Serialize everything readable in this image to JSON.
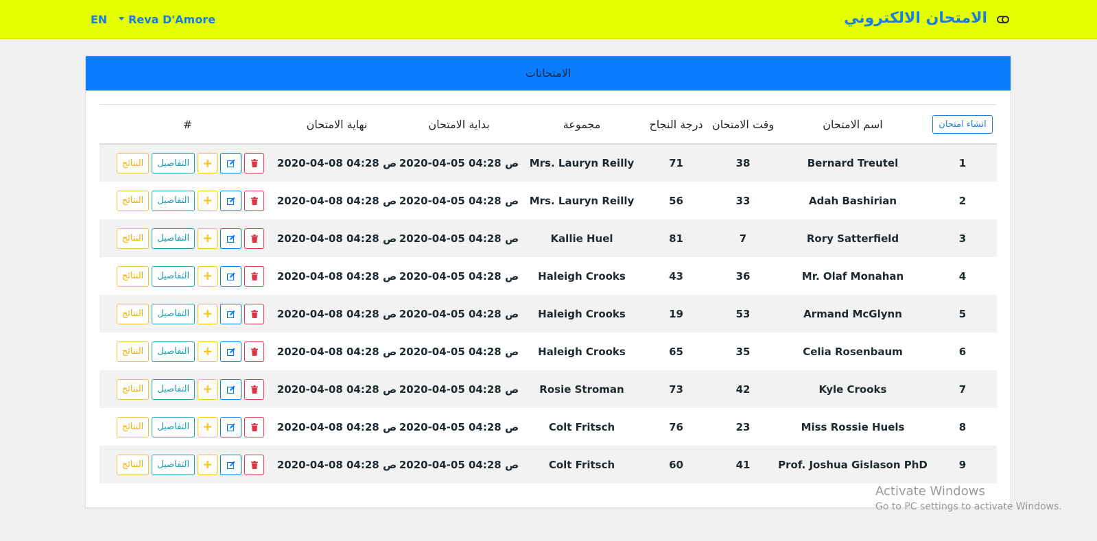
{
  "navbar": {
    "brand": "الامتحان الالكتروني",
    "lang": "EN",
    "user": "Reva D'Amore"
  },
  "card": {
    "title": "الامتحانات"
  },
  "table": {
    "create_button": "انشاء امتحان",
    "headers": {
      "name": "اسم الامتحان",
      "time": "وقت الامتحان",
      "pass": "درجة النجاح",
      "group": "مجموعة",
      "start": "بداية الامتحان",
      "end": "نهاية الامتحان",
      "hash": "#"
    },
    "action_labels": {
      "results": "النتائج",
      "details": "التفاصيل",
      "add": "+"
    },
    "rows": [
      {
        "num": "1",
        "name": "Bernard Treutel",
        "time": "38",
        "pass": "71",
        "group": "Mrs. Lauryn Reilly",
        "start": "2020-04-05 04:28 ص",
        "end": "2020-04-08 04:28 ص"
      },
      {
        "num": "2",
        "name": "Adah Bashirian",
        "time": "33",
        "pass": "56",
        "group": "Mrs. Lauryn Reilly",
        "start": "2020-04-05 04:28 ص",
        "end": "2020-04-08 04:28 ص"
      },
      {
        "num": "3",
        "name": "Rory Satterfield",
        "time": "7",
        "pass": "81",
        "group": "Kallie Huel",
        "start": "2020-04-05 04:28 ص",
        "end": "2020-04-08 04:28 ص"
      },
      {
        "num": "4",
        "name": "Mr. Olaf Monahan",
        "time": "36",
        "pass": "43",
        "group": "Haleigh Crooks",
        "start": "2020-04-05 04:28 ص",
        "end": "2020-04-08 04:28 ص"
      },
      {
        "num": "5",
        "name": "Armand McGlynn",
        "time": "53",
        "pass": "19",
        "group": "Haleigh Crooks",
        "start": "2020-04-05 04:28 ص",
        "end": "2020-04-08 04:28 ص"
      },
      {
        "num": "6",
        "name": "Celia Rosenbaum",
        "time": "35",
        "pass": "65",
        "group": "Haleigh Crooks",
        "start": "2020-04-05 04:28 ص",
        "end": "2020-04-08 04:28 ص"
      },
      {
        "num": "7",
        "name": "Kyle Crooks",
        "time": "42",
        "pass": "73",
        "group": "Rosie Stroman",
        "start": "2020-04-05 04:28 ص",
        "end": "2020-04-08 04:28 ص"
      },
      {
        "num": "8",
        "name": "Miss Rossie Huels",
        "time": "23",
        "pass": "76",
        "group": "Colt Fritsch",
        "start": "2020-04-05 04:28 ص",
        "end": "2020-04-08 04:28 ص"
      },
      {
        "num": "9",
        "name": "Prof. Joshua Gislason PhD",
        "time": "41",
        "pass": "60",
        "group": "Colt Fritsch",
        "start": "2020-04-05 04:28 ص",
        "end": "2020-04-08 04:28 ص"
      }
    ]
  },
  "watermark": {
    "line1": "Activate Windows",
    "line2": "Go to PC settings to activate Windows."
  },
  "colors": {
    "navbar_bg": "#e4ff00",
    "header_bg": "#0a7cff",
    "accent": "#1a7ee0"
  },
  "icons": {
    "brand": "toggle-icon",
    "edit": "edit-icon",
    "delete": "trash-icon",
    "caret": "caret-down-icon"
  }
}
